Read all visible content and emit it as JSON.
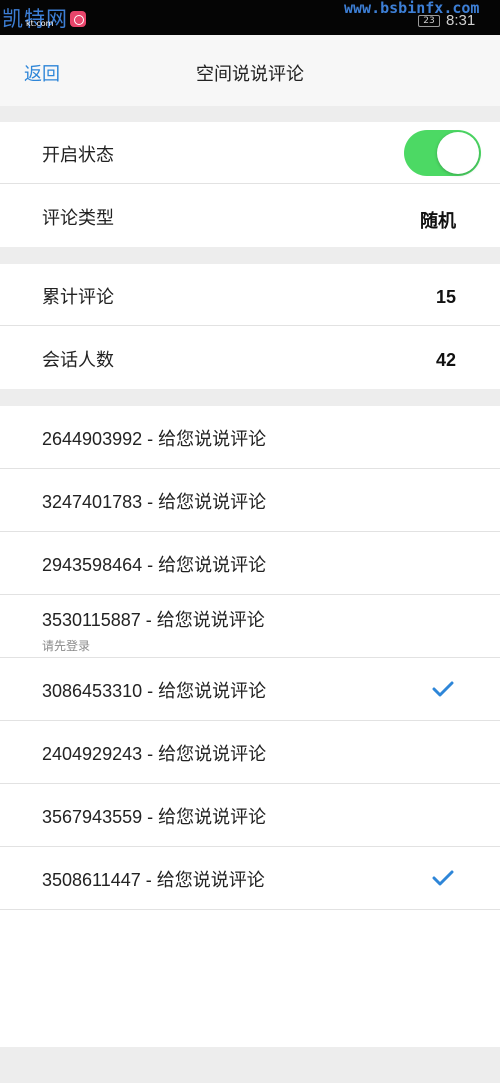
{
  "status_bar": {
    "logo_text": "凯特网",
    "logo_sub": "kt.com",
    "watermark": "www.bsbinfx.com",
    "battery": "23",
    "time": "8:31"
  },
  "nav": {
    "back_label": "返回",
    "title": "空间说说评论"
  },
  "settings": {
    "enable_label": "开启状态",
    "enabled": true,
    "comment_type_label": "评论类型",
    "comment_type_value": "随机"
  },
  "stats": {
    "total_label": "累计评论",
    "total_value": "15",
    "sessions_label": "会话人数",
    "sessions_value": "42"
  },
  "accounts": [
    {
      "qq": "2644903992",
      "sep": " - ",
      "action": "给您说说评论",
      "note": "",
      "checked": false
    },
    {
      "qq": "3247401783",
      "sep": " - ",
      "action": "给您说说评论",
      "note": "",
      "checked": false
    },
    {
      "qq": "2943598464",
      "sep": " - ",
      "action": "给您说说评论",
      "note": "",
      "checked": false
    },
    {
      "qq": "3530115887",
      "sep": " - ",
      "action": "给您说说评论",
      "note": "请先登录",
      "checked": false
    },
    {
      "qq": "3086453310",
      "sep": " - ",
      "action": "给您说说评论",
      "note": "",
      "checked": true
    },
    {
      "qq": "2404929243",
      "sep": " - ",
      "action": "给您说说评论",
      "note": "",
      "checked": false
    },
    {
      "qq": "3567943559",
      "sep": " - ",
      "action": "给您说说评论",
      "note": "",
      "checked": false
    },
    {
      "qq": "3508611447",
      "sep": " - ",
      "action": "给您说说评论",
      "note": "",
      "checked": true
    }
  ],
  "colors": {
    "accent": "#2e86d8",
    "toggle_on": "#4cd964",
    "check": "#2e86d8"
  }
}
